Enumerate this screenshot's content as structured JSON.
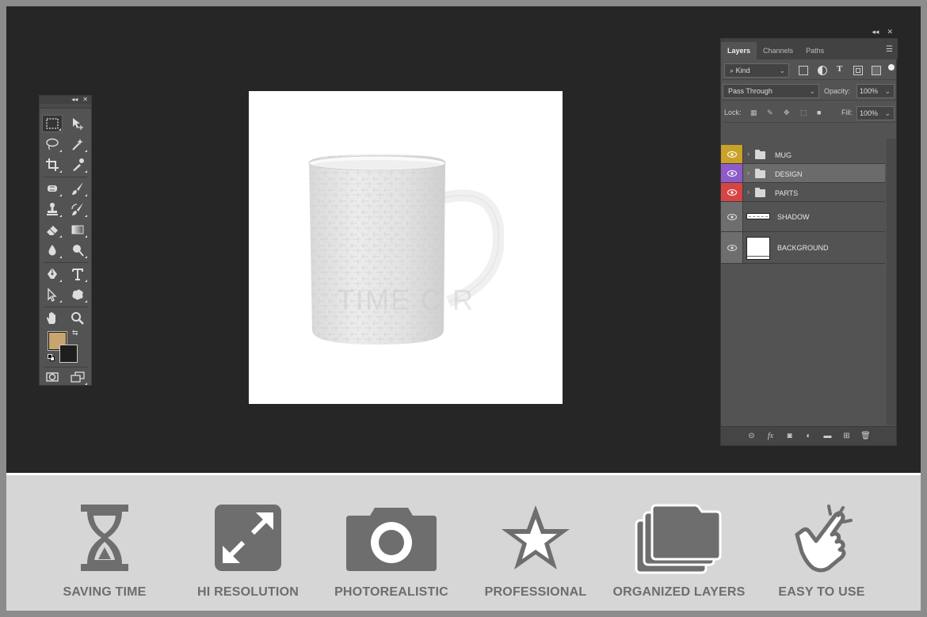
{
  "layers_panel": {
    "tabs": [
      "Layers",
      "Channels",
      "Paths"
    ],
    "filter_kind": "Kind",
    "blend_mode": "Pass Through",
    "opacity_label": "Opacity:",
    "opacity_value": "100%",
    "lock_label": "Lock:",
    "fill_label": "Fill:",
    "fill_value": "100%",
    "layers": [
      {
        "name": "MUG",
        "type": "group",
        "color": "#c9a227"
      },
      {
        "name": "DESIGN",
        "type": "group",
        "color": "#8e5cc9",
        "selected": true
      },
      {
        "name": "PARTS",
        "type": "group",
        "color": "#d64545"
      },
      {
        "name": "SHADOW",
        "type": "layer",
        "color": "#6e6e6e"
      },
      {
        "name": "BACKGROUND",
        "type": "layer",
        "color": "#6e6e6e"
      }
    ]
  },
  "toolbox": {
    "foreground_color": "#c8a46e",
    "background_color": "#1e1e1e"
  },
  "canvas": {
    "watermark": "TIME C   R"
  },
  "features": [
    {
      "label": "SAVING TIME",
      "icon": "hourglass-icon"
    },
    {
      "label": "HI RESOLUTION",
      "icon": "expand-arrows-icon"
    },
    {
      "label": "PHOTOREALISTIC",
      "icon": "camera-icon"
    },
    {
      "label": "PROFESSIONAL",
      "icon": "star-icon"
    },
    {
      "label": "ORGANIZED LAYERS",
      "icon": "stacked-folders-icon"
    },
    {
      "label": "EASY TO USE",
      "icon": "pointing-hand-icon"
    }
  ]
}
